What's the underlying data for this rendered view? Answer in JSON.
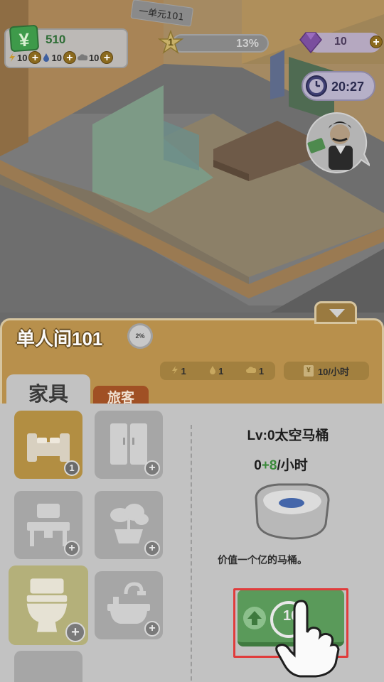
{
  "hud": {
    "money_symbol": "¥",
    "money": "510",
    "resources": [
      {
        "icon": "lightning-icon",
        "value": "10"
      },
      {
        "icon": "water-drop-icon",
        "value": "10"
      },
      {
        "icon": "cloud-icon",
        "value": "10"
      }
    ],
    "level": "1",
    "level_progress": "13%",
    "gems": "10",
    "clock": "20:27",
    "sign_text": "一单元101"
  },
  "room": {
    "title": "单人间101",
    "completion": "2%",
    "stats": [
      {
        "icon": "lightning-icon",
        "value": "1"
      },
      {
        "icon": "water-drop-icon",
        "value": "1"
      },
      {
        "icon": "cloud-icon",
        "value": "1"
      }
    ],
    "income": "10/小时"
  },
  "tabs": {
    "furniture": "家具",
    "guests": "旅客"
  },
  "furniture_slots": [
    {
      "icon": "bed-icon",
      "badge": "1",
      "selected": true
    },
    {
      "icon": "wardrobe-icon",
      "badge": "+"
    },
    {
      "icon": "table-chair-icon",
      "badge": "+"
    },
    {
      "icon": "plant-icon",
      "badge": "+"
    },
    {
      "icon": "toilet-icon",
      "badge": "+"
    },
    {
      "icon": "bathtub-icon",
      "badge": "+"
    }
  ],
  "detail": {
    "name": "Lv:0太空马桶",
    "rate_base": "0",
    "rate_gain": "+8",
    "rate_unit": "/小时",
    "description": "价值一个亿的马桶。",
    "upgrade_cost": "10"
  },
  "colors": {
    "panel": "#b8904c",
    "panel_body": "#c2c2c2",
    "upgrade_green": "#5a9a5a",
    "highlight_red": "#e03c3c"
  }
}
